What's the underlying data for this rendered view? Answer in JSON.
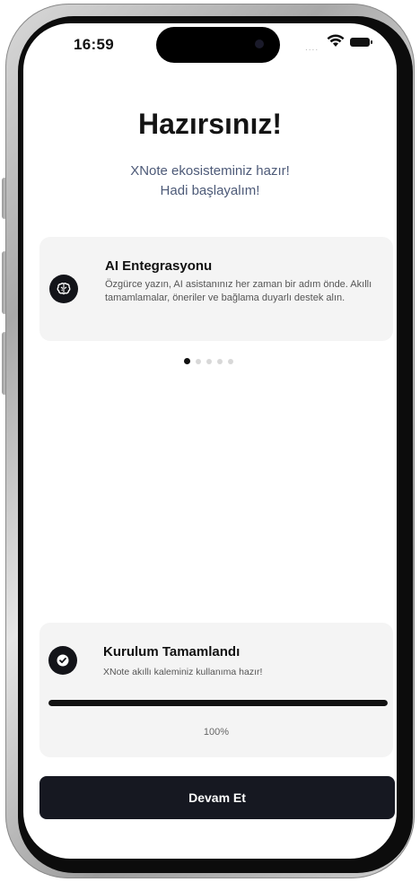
{
  "status_bar": {
    "time": "16:59",
    "signal": "....",
    "icons": [
      "wifi-icon",
      "battery-icon"
    ]
  },
  "header": {
    "title": "Hazırsınız!",
    "subtitle_line1": "XNote ekosisteminiz hazır!",
    "subtitle_line2": "Hadi başlayalım!"
  },
  "feature": {
    "icon": "brain-icon",
    "title": "AI Entegrasyonu",
    "description": "Özgürce yazın, AI asistanınız her zaman bir adım önde. Akıllı tamamlamalar, öneriler ve bağlama duyarlı destek alın."
  },
  "pager": {
    "total": 5,
    "active_index": 0
  },
  "completion": {
    "icon": "check-circle-icon",
    "title": "Kurulum Tamamlandı",
    "description": "XNote akıllı kaleminiz kullanıma hazır!",
    "progress_fraction": 1.0,
    "progress_label": "100%"
  },
  "cta": {
    "label": "Devam Et"
  },
  "colors": {
    "primary": "#161821",
    "card_bg": "#f4f4f4",
    "subtitle": "#4d5a78"
  }
}
